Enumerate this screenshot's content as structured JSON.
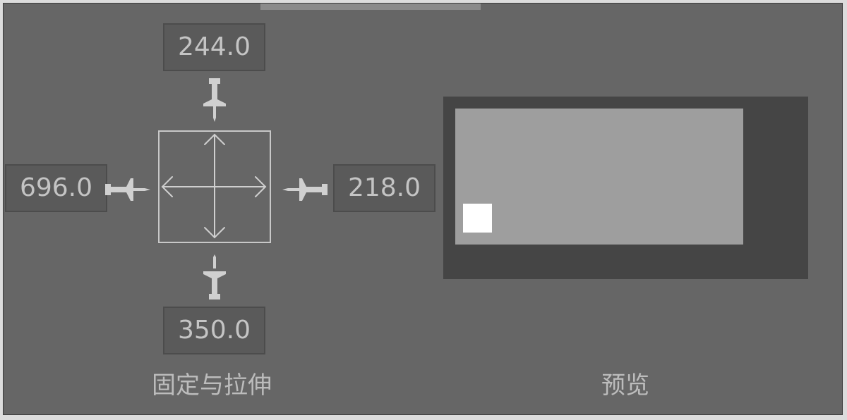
{
  "anchor_stretch": {
    "top_value": "244.0",
    "left_value": "696.0",
    "right_value": "218.0",
    "bottom_value": "350.0",
    "label": "固定与拉伸"
  },
  "preview": {
    "label": "预览"
  },
  "colors": {
    "panel_bg": "#666666",
    "field_bg": "#5a5a5a",
    "text": "#c4c4c4",
    "preview_frame": "#454545",
    "preview_rect": "#9e9e9e",
    "preview_marker": "#ffffff"
  },
  "icons": {
    "top": "pin-down-icon",
    "left": "pin-right-icon",
    "right": "pin-left-icon",
    "bottom": "pin-up-icon",
    "center": "move-arrows-icon"
  }
}
